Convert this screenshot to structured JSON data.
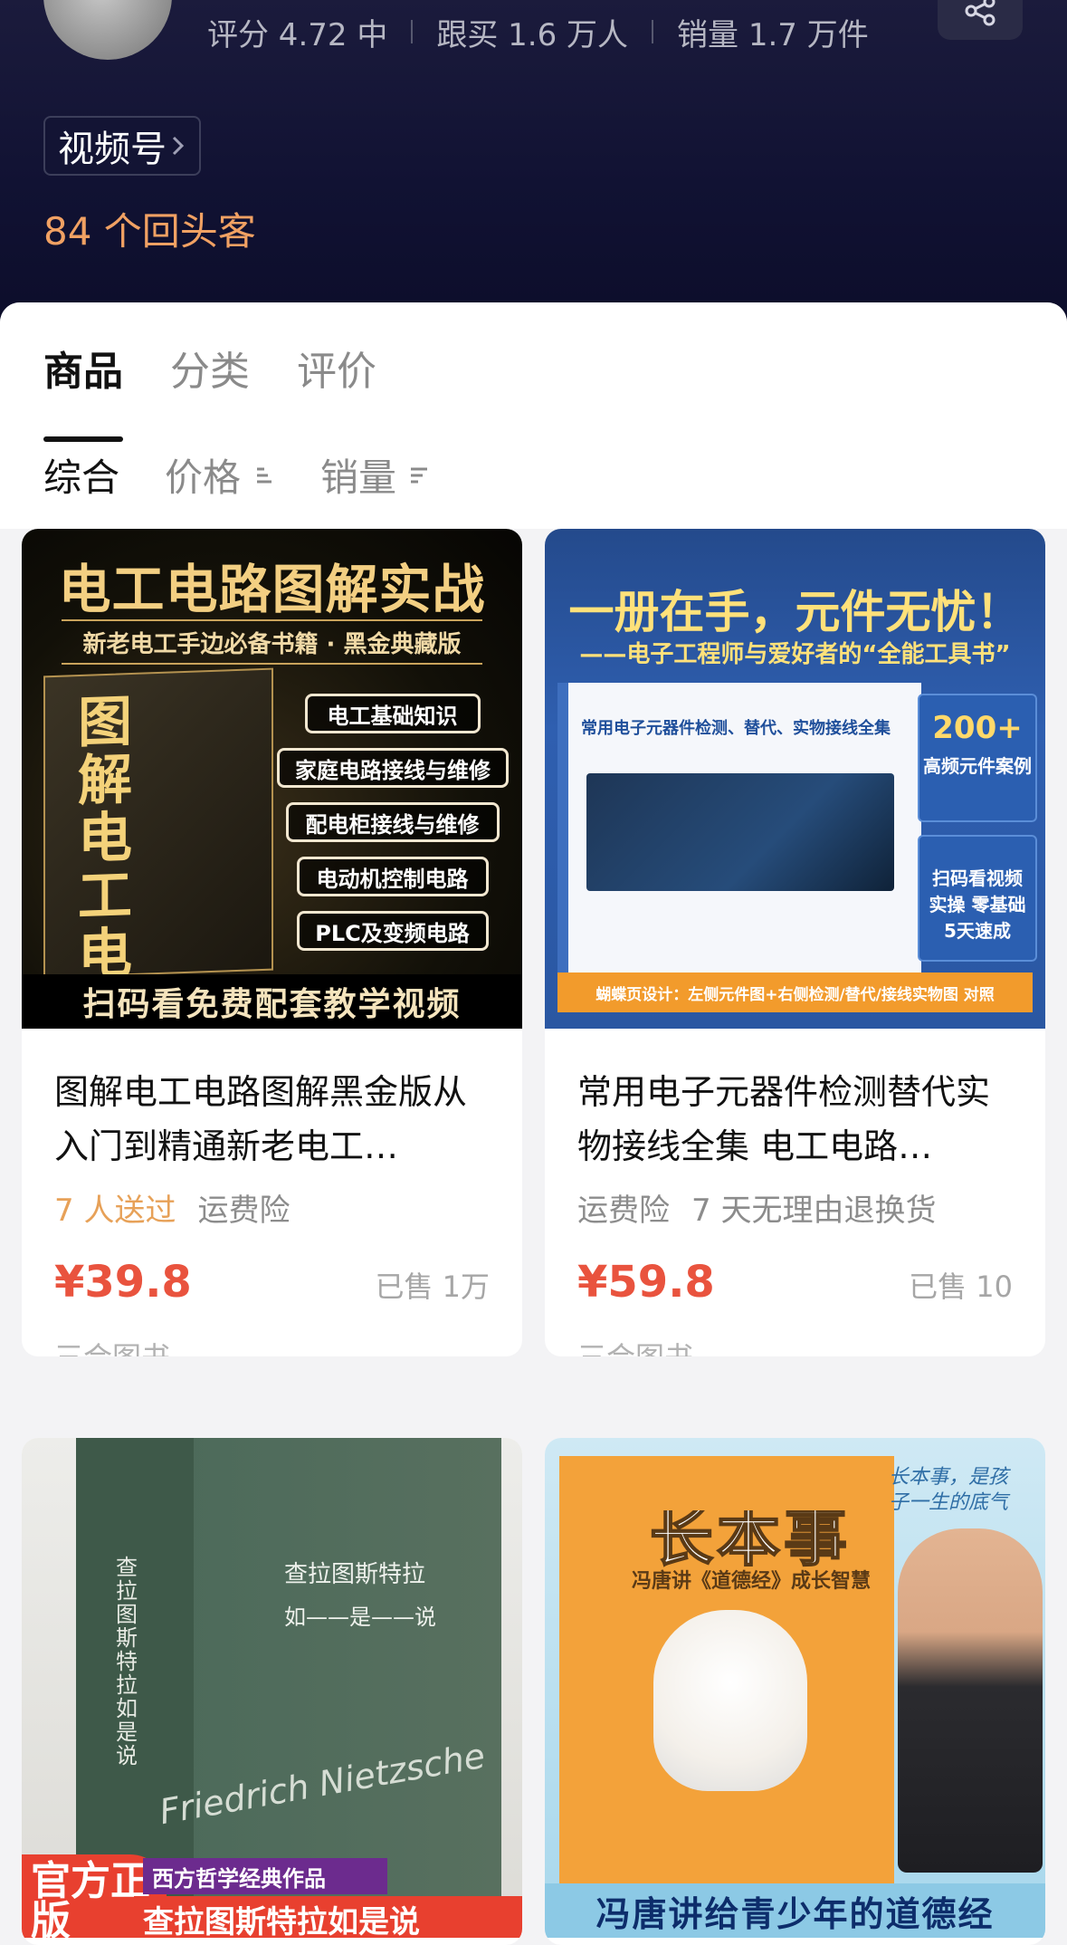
{
  "shop": {
    "stats": [
      {
        "label": "评分 4.72 中"
      },
      {
        "label": "跟买 1.6 万人"
      },
      {
        "label": "销量 1.7 万件"
      }
    ],
    "channel_tag": "视频号",
    "repeat_customers": "84 个回头客"
  },
  "tabs": [
    {
      "label": "商品",
      "active": true
    },
    {
      "label": "分类",
      "active": false
    },
    {
      "label": "评价",
      "active": false
    }
  ],
  "sorts": [
    {
      "label": "综合",
      "active": true
    },
    {
      "label": "价格",
      "active": false
    },
    {
      "label": "销量",
      "active": false
    }
  ],
  "products": [
    {
      "cover": {
        "headline": "电工电路图解实战",
        "subline": "新老电工手边必备书籍 · 黑金典藏版",
        "book_title": "图解电工电路",
        "pills": [
          "电工基础知识",
          "家庭电路接线与维修",
          "配电柜接线与维修",
          "电动机控制电路",
          "PLC及变频电路"
        ],
        "band": "扫码看免费配套教学视频"
      },
      "title": "图解电工电路图解黑金版从入门到精通新老电工…",
      "tags": [
        {
          "label": "7 人送过",
          "highlight": true
        },
        {
          "label": "运费险",
          "highlight": false
        }
      ],
      "price": "¥39.8",
      "sold": "已售 1万",
      "shop": "三合图书"
    },
    {
      "cover": {
        "headline": "一册在手，元件无忧！",
        "subline": "——电子工程师与爱好者的“全能工具书”",
        "book_title": "常用电子元器件检测、替代、实物接线全集",
        "side1_big": "200+",
        "side1_small": "高频元件案例",
        "side2_text": "扫码看视频实操 零基础5天速成",
        "band": "蝴蝶页设计：左侧元件图+右侧检测/替代/接线实物图 对照"
      },
      "title": "常用电子元器件检测替代实物接线全集 电工电路…",
      "tags": [
        {
          "label": "运费险",
          "highlight": false
        },
        {
          "label": "7 天无理由退换货",
          "highlight": false
        }
      ],
      "price": "¥59.8",
      "sold": "已售 10",
      "shop": "三合图书"
    },
    {
      "cover": {
        "spine": "查拉图斯特拉如是说",
        "title_cn": "查拉图斯特拉",
        "title_line2": "如——是——说",
        "script": "Friedrich Nietzsche",
        "badge": "官方正版",
        "ribbon": "西方哲学经典作品",
        "ribbon2": "查拉图斯特拉如是说"
      }
    },
    {
      "cover": {
        "title": "长本事",
        "subtitle": "冯唐讲《道德经》成长智慧",
        "quote": "长本事，是孩子一生的底气",
        "band": "冯唐讲给青少年的道德经"
      }
    }
  ],
  "colors": {
    "header_bg": "#111233",
    "price": "#e9533e",
    "highlight_tag": "#e7a158",
    "repeat_customers": "#f1a163"
  }
}
